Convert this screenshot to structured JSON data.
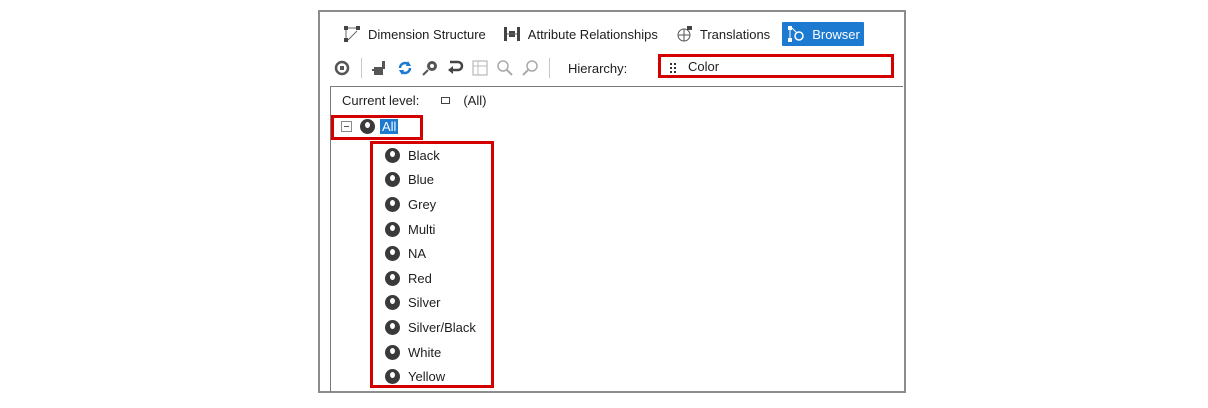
{
  "tabs": [
    {
      "label": "Dimension Structure",
      "icon": "dimension-structure-icon",
      "active": false
    },
    {
      "label": "Attribute Relationships",
      "icon": "attribute-relationships-icon",
      "active": false
    },
    {
      "label": "Translations",
      "icon": "translations-icon",
      "active": false
    },
    {
      "label": "Browser",
      "icon": "browser-icon",
      "active": true
    }
  ],
  "toolbar": {
    "icons": [
      "process-icon",
      "reconnect-icon",
      "refresh-icon",
      "member-properties-icon",
      "reset-icon",
      "filter-icon",
      "zoom-in-icon",
      "find-icon"
    ],
    "hierarchy_label": "Hierarchy:",
    "hierarchy_value": "Color"
  },
  "tree": {
    "current_level_label": "Current level:",
    "current_level_value": "(All)",
    "root_label": "All",
    "members": [
      "Black",
      "Blue",
      "Grey",
      "Multi",
      "NA",
      "Red",
      "Silver",
      "Silver/Black",
      "White",
      "Yellow"
    ]
  },
  "colors": {
    "accent": "#1c7ad0",
    "highlight": "#d40000",
    "border": "#8c8c8c"
  }
}
